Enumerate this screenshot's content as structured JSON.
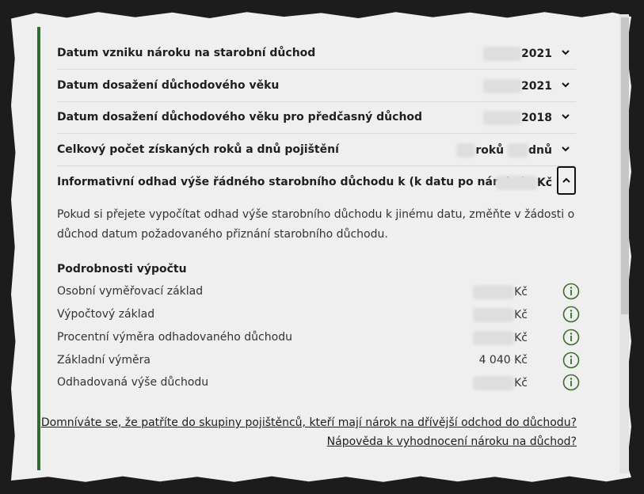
{
  "rows": [
    {
      "label": "Datum vzniku nároku na starobní důchod",
      "value": "2021",
      "blur_width": 48
    },
    {
      "label": "Datum dosažení důchodového věku",
      "value": "2021",
      "blur_width": 48
    },
    {
      "label": "Datum dosažení důchodového věku pro předčasný důchod",
      "value": "2018",
      "blur_width": 48
    },
    {
      "label": "Celkový počet získaných roků a dnů pojištění",
      "value_part1": "roků",
      "value_part2": "dnů"
    },
    {
      "label": "Informativní odhad výše řádného starobního důchodu k (k datu po nároku)",
      "value": "Kč"
    }
  ],
  "description": "Pokud si přejete vypočítat odhad výše starobního důchodu k jinému datu, změňte v žádosti o důchod datum požadovaného přiznání starobního důchodu.",
  "details": {
    "title": "Podrobnosti výpočtu",
    "items": [
      {
        "label": "Osobní vyměřovací základ",
        "value": "Kč",
        "blurred": true
      },
      {
        "label": "Výpočtový základ",
        "value": "Kč",
        "blurred": true
      },
      {
        "label": "Procentní výměra odhadovaného důchodu",
        "value": "Kč",
        "blurred": true
      },
      {
        "label": "Základní výměra",
        "value": "4 040 Kč",
        "blurred": false
      },
      {
        "label": "Odhadovaná výše důchodu",
        "value": "Kč",
        "blurred": true
      }
    ]
  },
  "links": {
    "early_retirement": "Domníváte se, že patříte do skupiny pojištěnců, kteří mají nárok na dřívější odchod do důchodu?",
    "help": "Nápověda k vyhodnocení nároku na důchod?"
  },
  "colors": {
    "accent_green": "#2e6b2e",
    "info_icon": "#3d6b2e"
  }
}
